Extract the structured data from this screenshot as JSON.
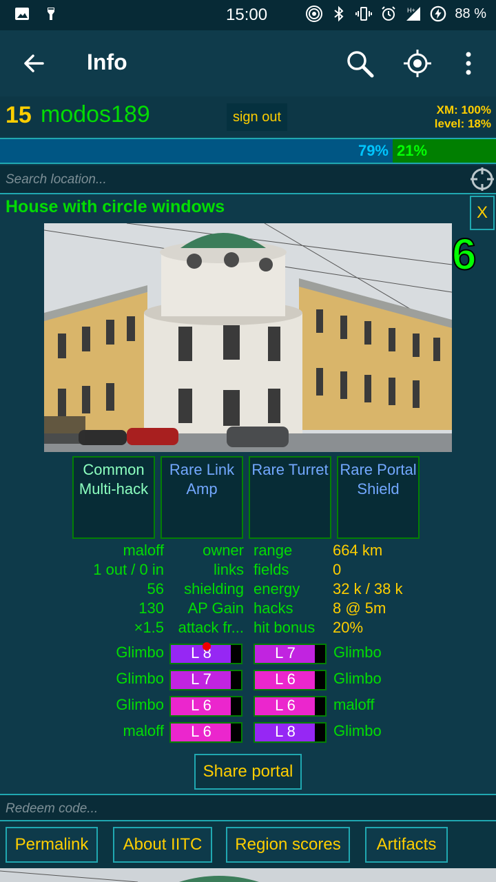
{
  "status_bar": {
    "time": "15:00",
    "battery": "88 %",
    "icons": [
      "image-icon",
      "thumb-icon",
      "hotspot-icon",
      "bluetooth-icon",
      "vibrate-icon",
      "alarm-icon",
      "signal-icon",
      "battery-icon"
    ]
  },
  "toolbar": {
    "title": "Info",
    "icons": [
      "back-arrow-icon",
      "search-icon",
      "locate-icon",
      "more-vert-icon"
    ]
  },
  "player": {
    "level": "15",
    "nickname": "modos189",
    "sign_out": "sign out",
    "xm": "XM: 100%",
    "level_progress": "level: 18%"
  },
  "score": {
    "resistance": "79%",
    "enlightened": "21%"
  },
  "search": {
    "placeholder": "Search location..."
  },
  "portal": {
    "title": "House with circle windows",
    "close": "X",
    "level": "6",
    "mods": [
      {
        "rarity": "common",
        "label": "Common Multi-hack"
      },
      {
        "rarity": "rare",
        "label": "Rare Link Amp"
      },
      {
        "rarity": "rare",
        "label": "Rare Turret"
      },
      {
        "rarity": "rare",
        "label": "Rare Portal Shield"
      }
    ],
    "stats": [
      {
        "v1": "maloff",
        "k1": "owner",
        "k2": "range",
        "v2": "664 km"
      },
      {
        "v1": "1 out / 0 in",
        "k1": "links",
        "k2": "fields",
        "v2": "0"
      },
      {
        "v1": "56",
        "k1": "shielding",
        "k2": "energy",
        "v2": "32 k / 38 k"
      },
      {
        "v1": "130",
        "k1": "AP Gain",
        "k2": "hacks",
        "v2": "8 @ 5m"
      },
      {
        "v1": "×1.5",
        "k1": "attack fr...",
        "k2": "hit bonus",
        "v2": "20%"
      }
    ],
    "resonators": [
      {
        "owner_l": "Glimbo",
        "lvl_l": "L 8",
        "fill_l": 0.85,
        "color_l": "#9627f4",
        "lvl_r": "L 7",
        "fill_r": 0.85,
        "color_r": "#c124e0",
        "owner_r": "Glimbo"
      },
      {
        "owner_l": "Glimbo",
        "lvl_l": "L 7",
        "fill_l": 0.85,
        "color_l": "#c124e0",
        "lvl_r": "L 6",
        "fill_r": 0.85,
        "color_r": "#eb26cd",
        "owner_r": "Glimbo"
      },
      {
        "owner_l": "Glimbo",
        "lvl_l": "L 6",
        "fill_l": 0.85,
        "color_l": "#eb26cd",
        "lvl_r": "L 6",
        "fill_r": 0.85,
        "color_r": "#eb26cd",
        "owner_r": "maloff"
      },
      {
        "owner_l": "maloff",
        "lvl_l": "L 6",
        "fill_l": 0.85,
        "color_l": "#eb26cd",
        "lvl_r": "L 8",
        "fill_r": 0.85,
        "color_r": "#9627f4",
        "owner_r": "Glimbo"
      }
    ],
    "share": "Share portal"
  },
  "redeem": {
    "placeholder": "Redeem code..."
  },
  "links": {
    "permalink": "Permalink",
    "about": "About IITC",
    "region": "Region scores",
    "artifacts": "Artifacts"
  }
}
